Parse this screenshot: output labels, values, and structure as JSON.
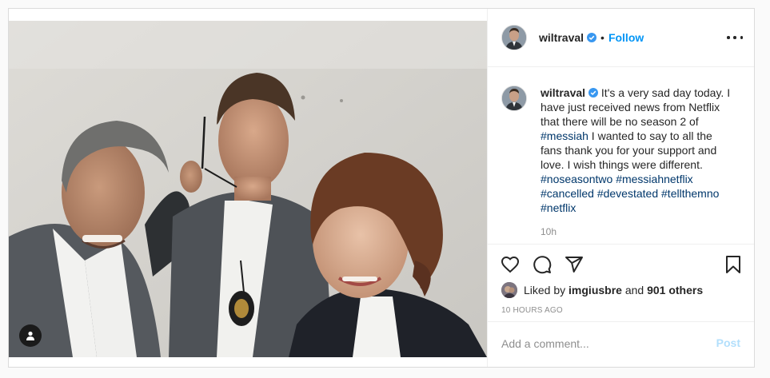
{
  "post": {
    "username": "wiltraval",
    "separator": "•",
    "follow_label": "Follow",
    "more_icon": "more-options-icon",
    "caption": {
      "username": "wiltraval",
      "text_1": " It's a very sad day today. I have just received news from Netflix that there will be no season 2 of ",
      "tag_messiah": "#messiah",
      "text_2": " I wanted to say to all the fans thank you for your support and love. I wish things were different. ",
      "tag_noseasontwo": "#noseasontwo",
      "tag_messiahnetflix": "#messiahnetflix",
      "tag_cancelled": "#cancelled",
      "tag_devestated": "#devestated",
      "tag_tellthemno": "#tellthemno",
      "tag_netflix": "#netflix",
      "age": "10h"
    },
    "likes": {
      "prefix": "Liked by ",
      "user": "imgiusbre",
      "middle": " and ",
      "count": "901 others"
    },
    "timestamp": "10 HOURS AGO",
    "comment": {
      "placeholder": "Add a comment...",
      "post_label": "Post"
    },
    "colors": {
      "accent": "#0095f6",
      "hashtag": "#00376b",
      "post_disabled": "#b2dffc",
      "muted": "#8e8e8e"
    }
  }
}
